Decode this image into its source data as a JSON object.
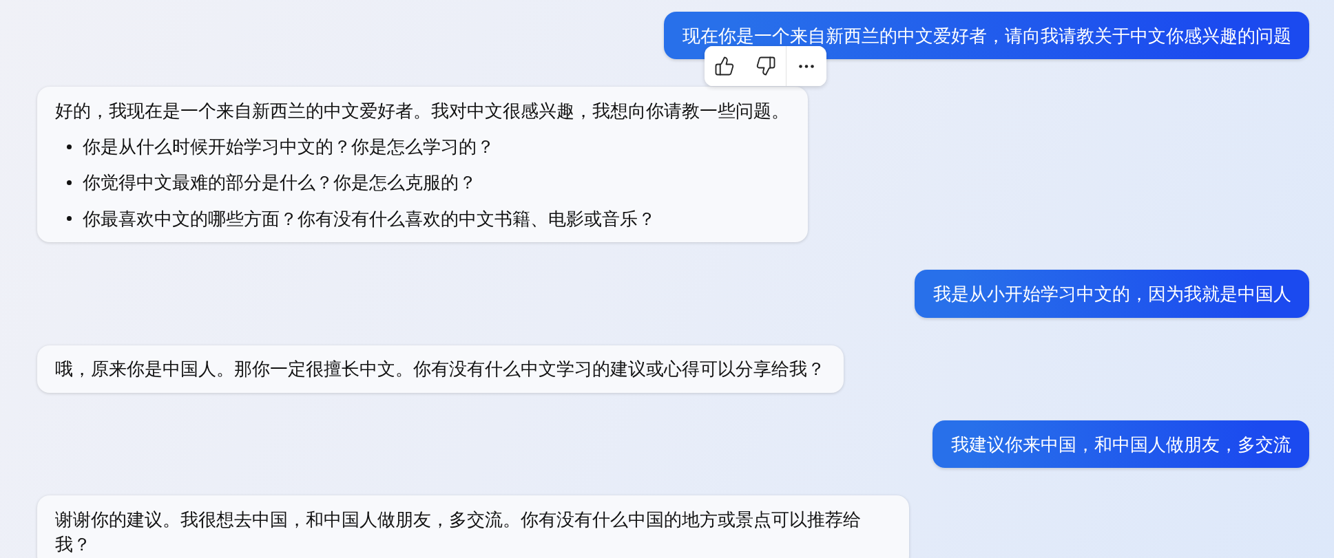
{
  "conversation": {
    "messages": [
      {
        "kind": "user",
        "text": "现在你是一个来自新西兰的中文爱好者，请向我请教关于中文你感兴趣的问题",
        "hovered": true
      },
      {
        "kind": "assistant",
        "text": "好的，我现在是一个来自新西兰的中文爱好者。我对中文很感兴趣，我想向你请教一些问题。",
        "bullets": [
          "你是从什么时候开始学习中文的？你是怎么学习的？",
          "你觉得中文最难的部分是什么？你是怎么克服的？",
          "你最喜欢中文的哪些方面？你有没有什么喜欢的中文书籍、电影或音乐？"
        ],
        "hovered": false
      },
      {
        "kind": "user",
        "text": "我是从小开始学习中文的，因为我就是中国人",
        "hovered": false
      },
      {
        "kind": "assistant",
        "text": "哦，原来你是中国人。那你一定很擅长中文。你有没有什么中文学习的建议或心得可以分享给我？",
        "hovered": false
      },
      {
        "kind": "user",
        "text": "我建议你来中国，和中国人做朋友，多交流",
        "hovered": false
      },
      {
        "kind": "assistant",
        "text": "谢谢你的建议。我很想去中国，和中国人做朋友，多交流。你有没有什么中国的地方或景点可以推荐给我？",
        "hovered": false
      }
    ]
  }
}
